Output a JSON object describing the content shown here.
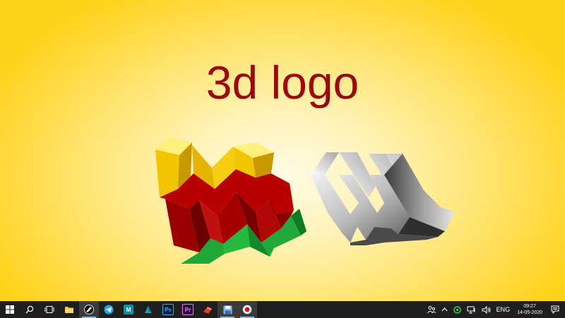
{
  "slide": {
    "title": "3d logo"
  },
  "taskbar": {
    "pinned_apps": [
      {
        "name": "start-button",
        "glyph": ""
      },
      {
        "name": "search-button",
        "glyph": ""
      },
      {
        "name": "task-view-button",
        "glyph": ""
      },
      {
        "name": "file-explorer-app",
        "glyph": ""
      },
      {
        "name": "inkscape-app",
        "glyph": ""
      },
      {
        "name": "telegram-app",
        "glyph": ""
      },
      {
        "name": "maya-app",
        "glyph": "M"
      },
      {
        "name": "3d-app",
        "glyph": ""
      },
      {
        "name": "photoshop-app",
        "glyph": "Ps"
      },
      {
        "name": "premiere-pro-app",
        "glyph": "Pr"
      },
      {
        "name": "sketchup-app",
        "glyph": ""
      },
      {
        "name": "save-app",
        "glyph": ""
      },
      {
        "name": "screen-recorder-app",
        "glyph": ""
      }
    ],
    "language": "ENG",
    "time": "09:27",
    "date": "14-05-2020"
  },
  "colors": {
    "title": "#9a0a0a",
    "logo_yellow": "#ffd200",
    "logo_red": "#a00000",
    "logo_green": "#1fa838",
    "taskbar_bg": "#1f1f1f"
  }
}
